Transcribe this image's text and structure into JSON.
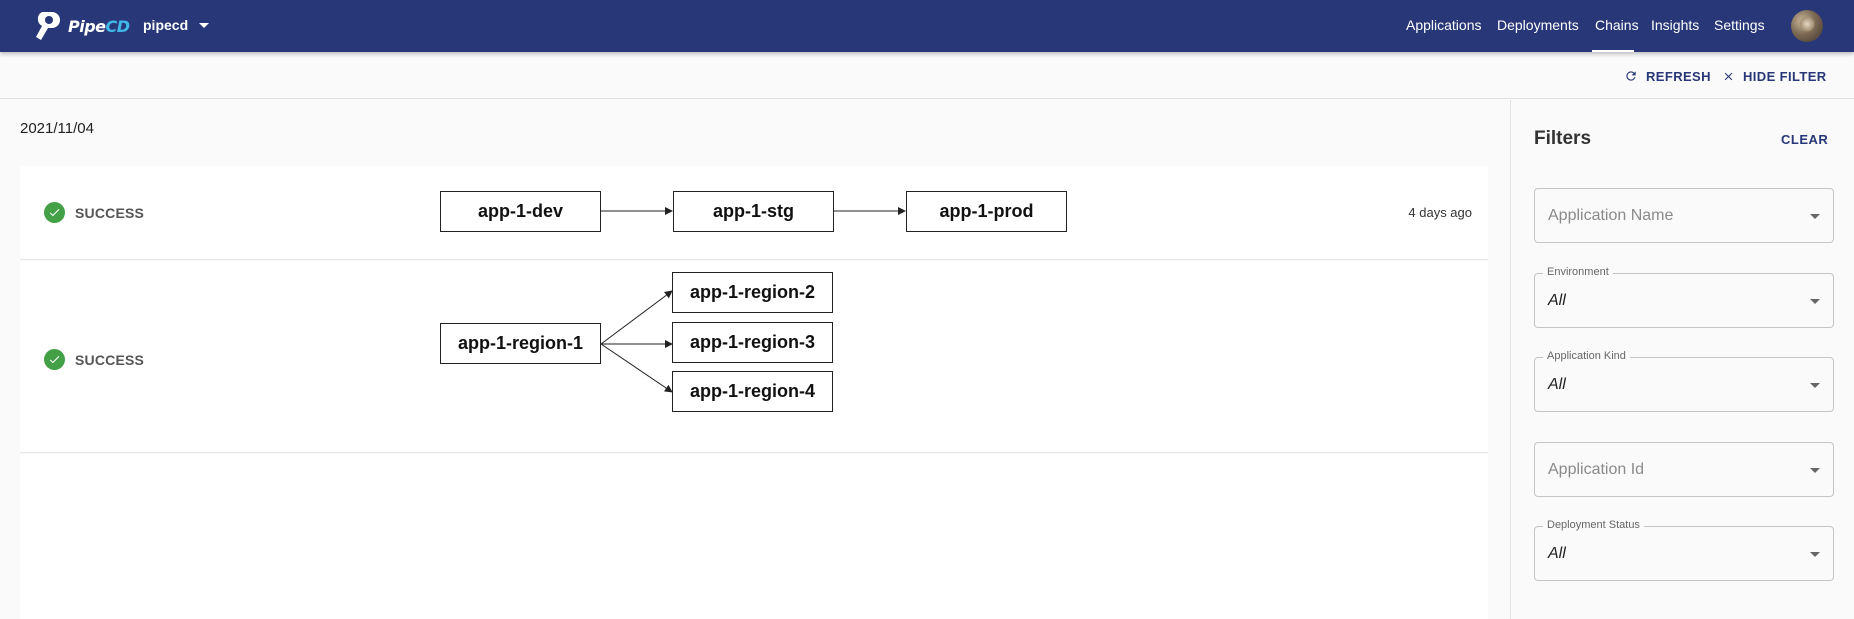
{
  "header": {
    "logo_text_main": "Pipe",
    "logo_text_accent": "CD",
    "project": "pipecd",
    "nav": [
      "Applications",
      "Deployments",
      "Chains",
      "Insights",
      "Settings"
    ],
    "active_nav": "Chains"
  },
  "toolbar": {
    "refresh_label": "REFRESH",
    "hide_filter_label": "HIDE FILTER"
  },
  "main": {
    "date": "2021/11/04",
    "chains": [
      {
        "status": "SUCCESS",
        "time_ago": "4 days ago",
        "nodes": [
          "app-1-dev",
          "app-1-stg",
          "app-1-prod"
        ]
      },
      {
        "status": "SUCCESS",
        "time_ago": "",
        "nodes": [
          "app-1-region-1",
          "app-1-region-2",
          "app-1-region-3",
          "app-1-region-4"
        ]
      }
    ]
  },
  "filters": {
    "title": "Filters",
    "clear_label": "CLEAR",
    "application_name": {
      "placeholder": "Application Name"
    },
    "environment": {
      "label": "Environment",
      "value": "All"
    },
    "application_kind": {
      "label": "Application Kind",
      "value": "All"
    },
    "application_id": {
      "placeholder": "Application Id"
    },
    "deployment_status": {
      "label": "Deployment Status",
      "value": "All"
    }
  },
  "colors": {
    "appbar": "#283778",
    "accent": "#40b8e8",
    "success": "#43a047"
  }
}
